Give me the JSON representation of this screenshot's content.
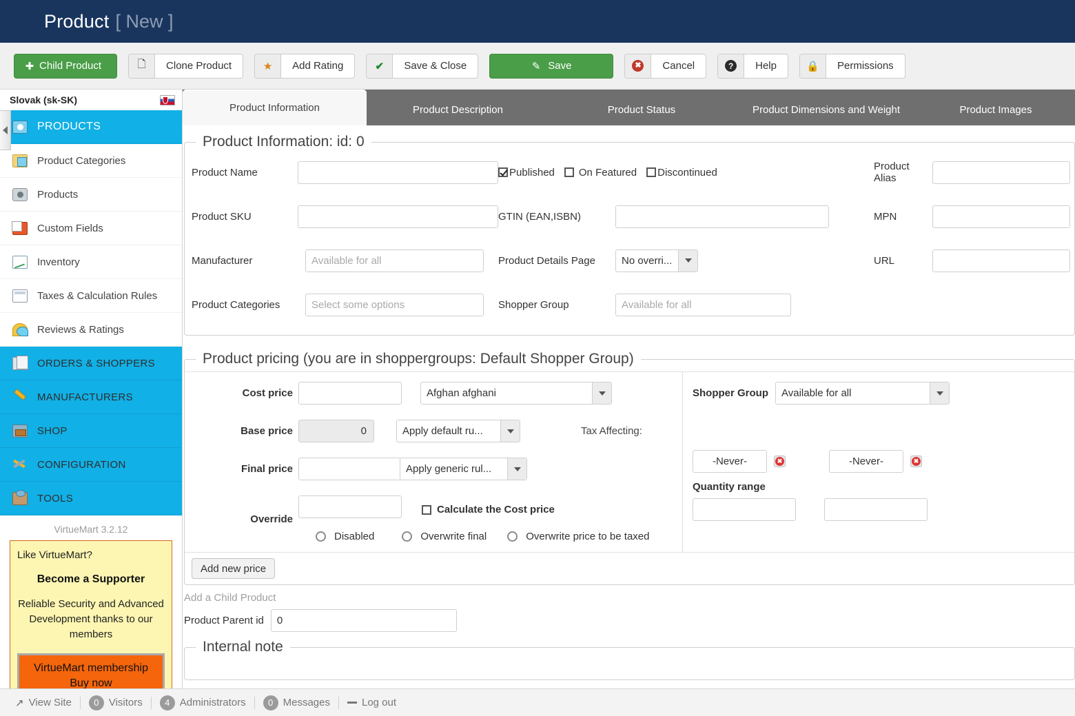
{
  "header": {
    "title": "Product",
    "subtitle": "[ New ]"
  },
  "toolbar": {
    "buttons": [
      {
        "label": "Child Product",
        "icon": "plus-circle-icon",
        "style": "green"
      },
      {
        "label": "Clone Product",
        "icon": "copy-icon",
        "style": "plain"
      },
      {
        "label": "Add Rating",
        "icon": "star-icon",
        "style": "plain"
      },
      {
        "label": "Save & Close",
        "icon": "check-icon",
        "style": "plain"
      },
      {
        "label": "Save",
        "icon": "edit-icon",
        "style": "green"
      },
      {
        "label": "Cancel",
        "icon": "cancel-icon",
        "style": "plain"
      },
      {
        "label": "Help",
        "icon": "help-icon",
        "style": "plain"
      },
      {
        "label": "Permissions",
        "icon": "lock-icon",
        "style": "plain"
      }
    ]
  },
  "sidebar": {
    "language": "Slovak (sk-SK)",
    "flag": "slovakia-flag-icon",
    "items": [
      {
        "label": "PRODUCTS",
        "icon": "products-icon",
        "type": "active"
      },
      {
        "label": "Product Categories",
        "icon": "folder-icon",
        "type": "child"
      },
      {
        "label": "Products",
        "icon": "camera-icon",
        "type": "child"
      },
      {
        "label": "Custom Fields",
        "icon": "custom-fields-icon",
        "type": "child"
      },
      {
        "label": "Inventory",
        "icon": "inventory-chart-icon",
        "type": "child"
      },
      {
        "label": "Taxes & Calculation Rules",
        "icon": "calculator-icon",
        "type": "child"
      },
      {
        "label": "Reviews & Ratings",
        "icon": "chat-bubble-icon",
        "type": "child"
      },
      {
        "label": "ORDERS & SHOPPERS",
        "icon": "orders-icon",
        "type": "section"
      },
      {
        "label": "MANUFACTURERS",
        "icon": "wrench-icon",
        "type": "section"
      },
      {
        "label": "SHOP",
        "icon": "shop-icon",
        "type": "section"
      },
      {
        "label": "CONFIGURATION",
        "icon": "configuration-icon",
        "type": "section"
      },
      {
        "label": "TOOLS",
        "icon": "tools-icon",
        "type": "section"
      }
    ],
    "version": "VirtueMart 3.2.12",
    "promo": {
      "line1": "Like VirtueMart?",
      "line2": "Become a Supporter",
      "line3": "Reliable Security and Advanced Development thanks to our members",
      "button_line1": "VirtueMart membership",
      "button_line2": "Buy now"
    }
  },
  "tabs": [
    {
      "label": "Product Information",
      "active": true
    },
    {
      "label": "Product Description",
      "active": false
    },
    {
      "label": "Product Status",
      "active": false
    },
    {
      "label": "Product Dimensions and Weight",
      "active": false
    },
    {
      "label": "Product Images",
      "active": false
    }
  ],
  "product_information": {
    "legend": "Product Information: id: 0",
    "product_name": {
      "label": "Product Name",
      "value": "",
      "placeholder": ""
    },
    "product_sku": {
      "label": "Product SKU",
      "value": "",
      "placeholder": ""
    },
    "manufacturer": {
      "label": "Manufacturer",
      "value": "",
      "placeholder": "Available for all"
    },
    "product_categories": {
      "label": "Product Categories",
      "value": "",
      "placeholder": "Select some options"
    },
    "published": {
      "label": "Published",
      "checked": true
    },
    "on_featured": {
      "label": "On Featured",
      "checked": false
    },
    "discontinued": {
      "label": "Discontinued",
      "checked": false
    },
    "gtin": {
      "label": "GTIN (EAN,ISBN)",
      "value": ""
    },
    "product_details_page": {
      "label": "Product Details Page",
      "value": "No overri..."
    },
    "shopper_group": {
      "label": "Shopper Group",
      "value": "",
      "placeholder": "Available for all"
    },
    "product_alias": {
      "label": "Product Alias",
      "value": ""
    },
    "mpn": {
      "label": "MPN",
      "value": ""
    },
    "url": {
      "label": "URL",
      "value": ""
    }
  },
  "product_pricing": {
    "legend": "Product pricing (you are in shoppergroups: Default Shopper Group)",
    "cost_price": {
      "label": "Cost price",
      "value": ""
    },
    "currency": {
      "value": "Afghan afghani"
    },
    "base_price": {
      "label": "Base price",
      "value": "0"
    },
    "base_price_rule": {
      "value": "Apply default ru..."
    },
    "final_price": {
      "label": "Final price",
      "value": ""
    },
    "final_price_rule": {
      "value": "Apply generic rul..."
    },
    "override": {
      "label": "Override",
      "value": ""
    },
    "calculate_cost_price": {
      "label": "Calculate the Cost price",
      "checked": false
    },
    "radios": [
      {
        "label": "Disabled",
        "selected": false
      },
      {
        "label": "Overwrite final",
        "selected": false
      },
      {
        "label": "Overwrite price to be taxed",
        "selected": false
      }
    ],
    "tax_affecting": {
      "label": "Tax Affecting:"
    },
    "shopper_group": {
      "label": "Shopper Group",
      "value": "Available for all"
    },
    "date_from": {
      "value": "-Never-"
    },
    "date_to": {
      "value": "-Never-"
    },
    "quantity_range": {
      "label": "Quantity range",
      "from": "",
      "to": ""
    },
    "add_new_price": "Add new price"
  },
  "child_product": {
    "heading": "Add a Child Product",
    "parent_id": {
      "label": "Product Parent id",
      "value": "0"
    }
  },
  "internal_note": {
    "legend": "Internal note"
  },
  "footer": {
    "view_site": "View Site",
    "visitors": {
      "count": "0",
      "label": "Visitors"
    },
    "administrators": {
      "count": "4",
      "label": "Administrators"
    },
    "messages": {
      "count": "0",
      "label": "Messages"
    },
    "log_out": "Log out"
  },
  "colors": {
    "header_bg": "#19355e",
    "accent_green": "#4a9e48",
    "sidebar_active": "#11b0e6",
    "promo_bg": "#fdf6b2",
    "promo_button": "#f4650c"
  }
}
